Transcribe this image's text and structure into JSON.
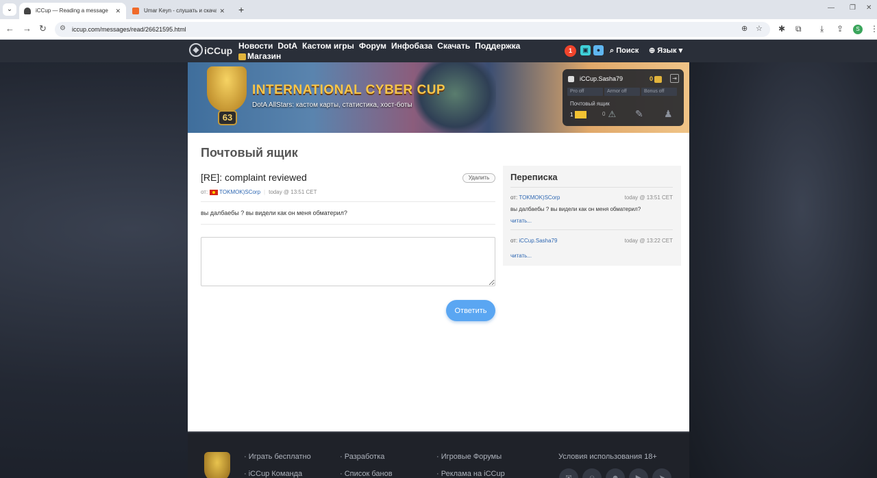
{
  "browser": {
    "tab_active_title": "iCCup — Reading a message fr",
    "tab_inactive_title": "Umar Keyn - слушать и скачать",
    "url": "iccup.com/messages/read/26621595.html"
  },
  "nav": {
    "logo": "iCCup",
    "links": [
      "Новости",
      "DotA",
      "Кастом игры",
      "Форум",
      "Инфобаза",
      "Скачать",
      "Поддержка"
    ],
    "shop": "Магазин",
    "notif_count": "1",
    "search": "Поиск",
    "language": "Язык"
  },
  "banner": {
    "level": "63",
    "title": "INTERNATIONAL CYBER CUP",
    "subtitle": "DotA AllStars: кастом карты, статистика, хост-боты"
  },
  "user_panel": {
    "username": "iCCup.Sasha79",
    "gold": "0",
    "stats": [
      "Pro off",
      "Armor off",
      "Bonus off"
    ],
    "mailbox_label": "Почтовый ящик",
    "mail_count": "1",
    "warn_count": "0"
  },
  "page": {
    "title": "Почтовый ящик",
    "subject": "[RE]: complaint reviewed",
    "delete": "Удалить",
    "from_prefix": "от:",
    "from_user": "TOKMOK)SCorp",
    "time": "today @ 13:51 CET",
    "body": "вы далбаебы ? вы видели как он меня обматерил?",
    "reply": "Ответить"
  },
  "sidebar": {
    "title": "Переписка",
    "items": [
      {
        "from_prefix": "от:",
        "user": "TOKMOK)SCorp",
        "time": "today @ 13:51 CET",
        "text": "вы далбаебы ? вы видели как он меня обматерил?",
        "read": "читать..."
      },
      {
        "from_prefix": "от:",
        "user": "iCCup.Sasha79",
        "time": "today @ 13:22 CET",
        "text": "",
        "read": "читать..."
      }
    ]
  },
  "footer": {
    "col1": [
      "Играть бесплатно",
      "iCCup Команда"
    ],
    "col2": [
      "Разработка",
      "Список банов"
    ],
    "col3": [
      "Игровые Форумы",
      "Реклама на iCCup"
    ],
    "terms": "Условия использования 18+"
  },
  "colors": {
    "accent": "#5aa6f2",
    "link": "#2e67b2",
    "notif": "#f0442c",
    "nav_bg": "#2a2f39"
  }
}
